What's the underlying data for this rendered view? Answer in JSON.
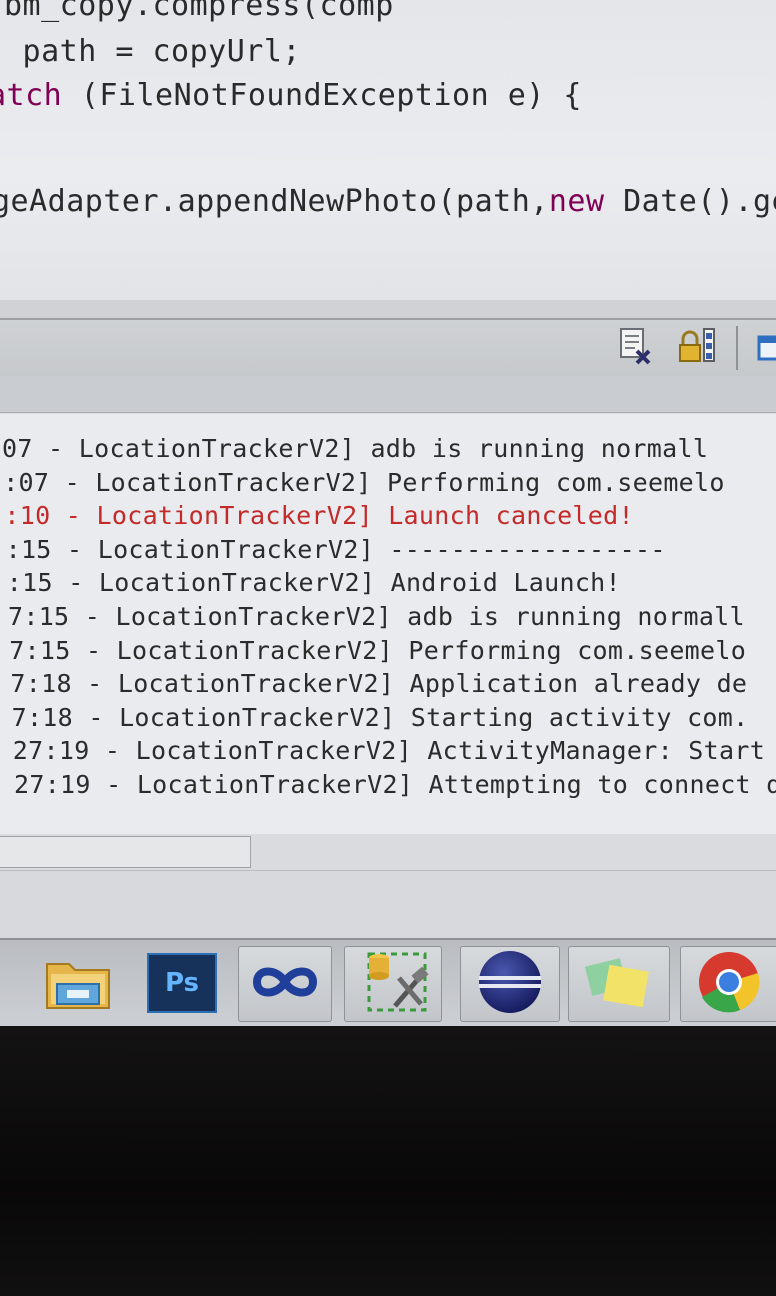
{
  "editor": {
    "lines": [
      {
        "parts": [
          {
            "text": "bm_copy.compress(comp"
          }
        ]
      },
      {
        "parts": [
          {
            "text": " path = copyUrl;"
          }
        ]
      },
      {
        "parts": [
          {
            "text": "atch",
            "kw": true
          },
          {
            "text": " (FileNotFoundException e) {"
          }
        ]
      },
      {
        "parts": [
          {
            "text": "geAdapter.appendNewPhoto(path,"
          },
          {
            "text": "new",
            "kw": true
          },
          {
            "text": " Date().get"
          }
        ]
      }
    ]
  },
  "console": {
    "toolbar_icons": [
      "clear-console-icon",
      "scroll-lock-icon",
      "pin-console-icon"
    ],
    "log_lines": [
      {
        "ts": "07",
        "source": "LocationTrackerV2]",
        "msg": "adb is running normall",
        "error": false
      },
      {
        "ts": ":07",
        "source": "LocationTrackerV2]",
        "msg": "Performing com.seemelo",
        "error": false
      },
      {
        "ts": ":10",
        "source": "LocationTrackerV2]",
        "msg": "Launch canceled!",
        "error": true
      },
      {
        "ts": ":15",
        "source": "LocationTrackerV2]",
        "msg": "------------------",
        "error": false
      },
      {
        "ts": ":15",
        "source": "LocationTrackerV2]",
        "msg": "Android Launch!",
        "error": false
      },
      {
        "ts": "7:15",
        "source": "LocationTrackerV2]",
        "msg": "adb is running normall",
        "error": false
      },
      {
        "ts": "7:15",
        "source": "LocationTrackerV2]",
        "msg": "Performing com.seemelo",
        "error": false
      },
      {
        "ts": "7:18",
        "source": "LocationTrackerV2]",
        "msg": "Application already de",
        "error": false
      },
      {
        "ts": "7:18",
        "source": "LocationTrackerV2]",
        "msg": "Starting activity com.",
        "error": false
      },
      {
        "ts": "27:19",
        "source": "LocationTrackerV2]",
        "msg": "ActivityManager: Start",
        "error": false
      },
      {
        "ts": "27:19",
        "source": "LocationTrackerV2]",
        "msg": "Attempting to connect d",
        "error": false
      }
    ]
  },
  "taskbar": {
    "apps": [
      {
        "name": "file-explorer-icon"
      },
      {
        "name": "photoshop-icon",
        "label": "Ps"
      },
      {
        "name": "visual-studio-icon"
      },
      {
        "name": "build-tools-icon"
      },
      {
        "name": "eclipse-icon"
      },
      {
        "name": "sticky-notes-icon"
      },
      {
        "name": "chrome-icon"
      }
    ]
  },
  "colors": {
    "keyword": "#7f0055",
    "error_text": "#c42a2a",
    "log_text": "#2b2b2b"
  }
}
